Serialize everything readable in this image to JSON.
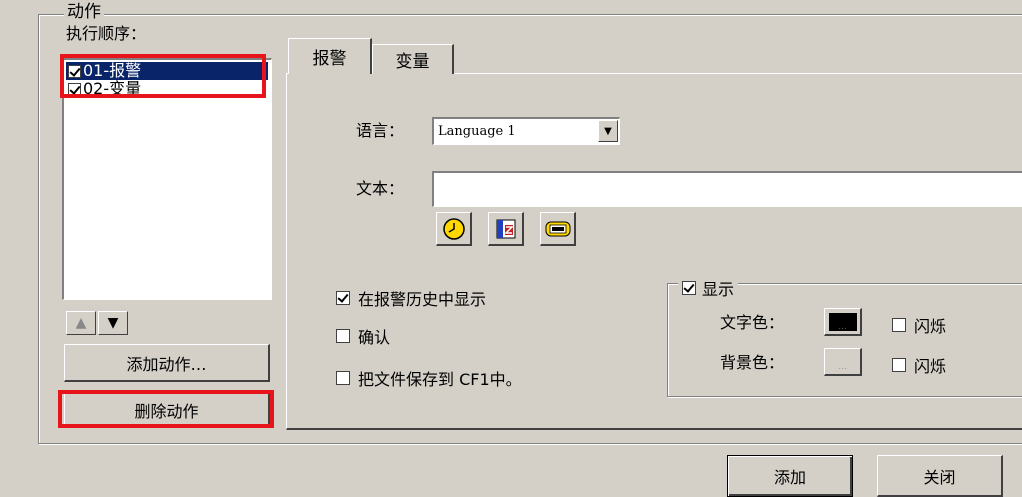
{
  "group": {
    "title": "动作"
  },
  "order_label": "执行顺序：",
  "actions": [
    {
      "label": "01-报警",
      "checked": true,
      "selected": true
    },
    {
      "label": "02-变量",
      "checked": true,
      "selected": false
    }
  ],
  "buttons": {
    "add_action": "添加动作…",
    "delete_action": "删除动作",
    "add": "添加",
    "close": "关闭"
  },
  "tabs": [
    {
      "label": "报警",
      "active": true
    },
    {
      "label": "变量",
      "active": false
    }
  ],
  "alarm": {
    "language_label": "语言：",
    "language_value": "Language 1",
    "text_label": "文本：",
    "text_value": "",
    "show_in_history": {
      "label": "在报警历史中显示",
      "checked": true
    },
    "confirm": {
      "label": "确认",
      "checked": false
    },
    "save_to_cf": {
      "label": "把文件保存到 CF1中。",
      "checked": false
    },
    "insert_icons": [
      "clock-icon",
      "variable-icon",
      "tag-icon"
    ]
  },
  "display": {
    "title": "显示",
    "checked": true,
    "text_color_label": "文字色：",
    "text_color": "#000000",
    "text_blink": {
      "label": "闪烁",
      "checked": false
    },
    "bg_color_label": "背景色：",
    "bg_color": "#d4d0c8",
    "bg_blink": {
      "label": "闪烁",
      "checked": false
    }
  },
  "highlight_color": "#e8141c"
}
